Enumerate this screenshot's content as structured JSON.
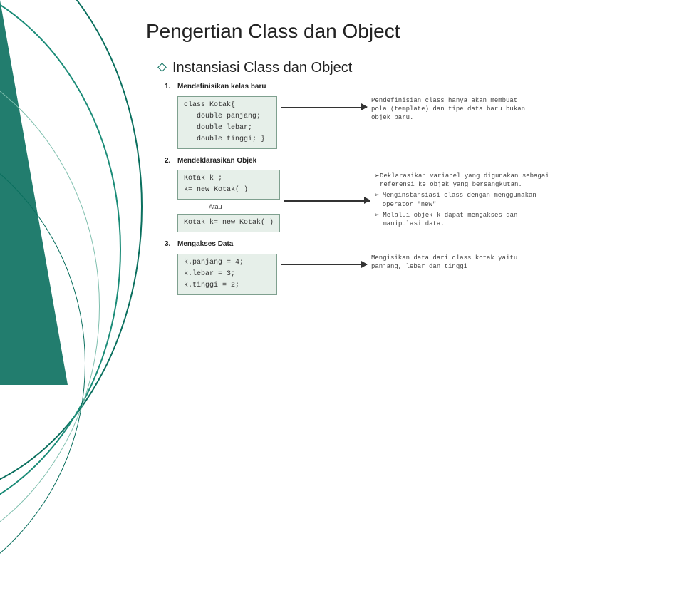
{
  "title": "Pengertian Class dan Object",
  "subtitle": "Instansiasi Class dan Object",
  "s1": {
    "num": "1.",
    "heading": "Mendefinisikan kelas baru",
    "code": "class Kotak{\n   double panjang;\n   double lebar;\n   double tinggi; }",
    "desc": "Pendefinisian class hanya akan membuat pola (template) dan tipe data baru bukan objek baru."
  },
  "s2": {
    "num": "2.",
    "heading": "Mendeklarasikan Objek",
    "code1": "Kotak k ;\nk= new Kotak( )",
    "atau": "Atau",
    "code2": "Kotak k= new Kotak( )",
    "b1": "Deklarasikan variabel yang digunakan sebagai referensi ke objek yang bersangkutan.",
    "b2": "Menginstansiasi class dengan menggunakan operator \"new\"",
    "b3": "Melalui objek k dapat mengakses dan manipulasi data."
  },
  "s3": {
    "num": "3.",
    "heading": "Mengakses Data",
    "code": "k.panjang = 4;\nk.lebar = 3;\nk.tinggi = 2;",
    "desc": "Mengisikan data dari class kotak yaitu panjang, lebar dan tinggi"
  }
}
